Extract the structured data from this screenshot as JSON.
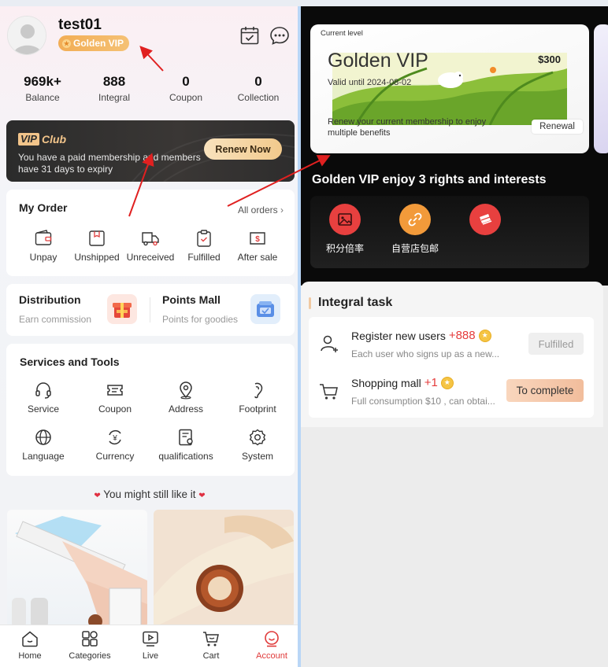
{
  "profile": {
    "username": "test01",
    "vip_badge": "Golden VIP"
  },
  "stats": [
    {
      "value": "969k+",
      "label": "Balance"
    },
    {
      "value": "888",
      "label": "Integral"
    },
    {
      "value": "0",
      "label": "Coupon"
    },
    {
      "value": "0",
      "label": "Collection"
    }
  ],
  "vip_club": {
    "logo_box": "VIP",
    "logo_text": "Club",
    "description": "You have a paid membership and members have 31 days to expiry",
    "renew_label": "Renew Now"
  },
  "my_order": {
    "title": "My Order",
    "all_orders": "All orders",
    "items": [
      {
        "label": "Unpay",
        "icon": "wallet-icon"
      },
      {
        "label": "Unshipped",
        "icon": "package-icon"
      },
      {
        "label": "Unreceived",
        "icon": "truck-icon"
      },
      {
        "label": "Fulfilled",
        "icon": "clipboard-check-icon"
      },
      {
        "label": "After sale",
        "icon": "dollar-return-icon"
      }
    ]
  },
  "distribution": {
    "title": "Distribution",
    "subtitle": "Earn commission"
  },
  "points_mall": {
    "title": "Points Mall",
    "subtitle": "Points for goodies"
  },
  "services": {
    "title": "Services and Tools",
    "items": [
      {
        "label": "Service",
        "icon": "headset-icon"
      },
      {
        "label": "Coupon",
        "icon": "ticket-icon"
      },
      {
        "label": "Address",
        "icon": "map-pin-icon"
      },
      {
        "label": "Footprint",
        "icon": "footprint-icon"
      },
      {
        "label": "Language",
        "icon": "globe-icon"
      },
      {
        "label": "Currency",
        "icon": "currency-icon"
      },
      {
        "label": "qualifications",
        "icon": "certificate-icon"
      },
      {
        "label": "System",
        "icon": "gear-icon"
      }
    ]
  },
  "recommend": {
    "title": "You might still like it"
  },
  "tabbar": [
    {
      "label": "Home",
      "icon": "home-icon"
    },
    {
      "label": "Categories",
      "icon": "grid-icon"
    },
    {
      "label": "Live",
      "icon": "play-icon"
    },
    {
      "label": "Cart",
      "icon": "cart-icon"
    },
    {
      "label": "Account",
      "icon": "account-icon",
      "active": true
    }
  ],
  "level_card": {
    "small_label": "Current level",
    "level_name": "Golden VIP",
    "valid_until": "Valid until 2024-08-02",
    "price": "$300",
    "description": "Renew your current membership to enjoy multiple benefits",
    "renewal_label": "Renewal"
  },
  "rights": {
    "title": "Golden VIP enjoy 3 rights and interests",
    "items": [
      {
        "label": "积分倍率",
        "icon": "image-icon"
      },
      {
        "label": "自营店包邮",
        "icon": "link-icon"
      },
      {
        "label": "",
        "icon": "ticket-icon"
      }
    ]
  },
  "integral_task": {
    "title": "Integral task",
    "tasks": [
      {
        "name": "Register new users",
        "points": "+888",
        "description": "Each user who signs up as a new...",
        "button": "Fulfilled",
        "icon": "add-user-icon"
      },
      {
        "name": "Shopping mall",
        "points": "+1",
        "description": "Full consumption $10 , can obtai...",
        "button": "To complete",
        "icon": "cart-icon"
      }
    ]
  },
  "colors": {
    "accent_red": "#e03a3a",
    "vip_gold": "#f2ad55",
    "renew_gold": "#f1c98c",
    "annotation_red": "#e02020"
  }
}
